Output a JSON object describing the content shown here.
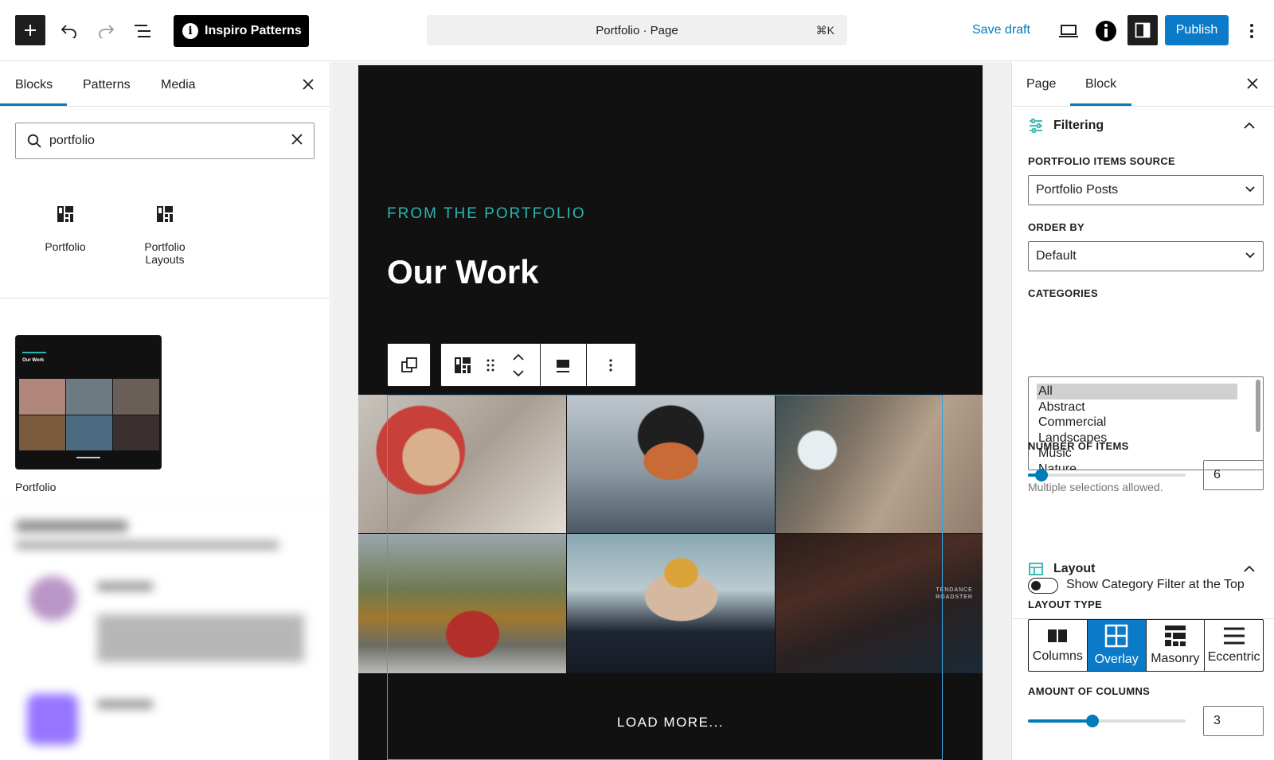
{
  "topbar": {
    "patterns_button": "Inspiro Patterns",
    "command_title": "Portfolio · Page",
    "command_shortcut": "⌘K",
    "save_draft": "Save draft",
    "publish": "Publish"
  },
  "inserter": {
    "tabs": [
      "Blocks",
      "Patterns",
      "Media"
    ],
    "active_tab": "Blocks",
    "search_value": "portfolio",
    "blocks": [
      {
        "label": "Portfolio"
      },
      {
        "label": "Portfolio Layouts"
      }
    ],
    "pattern_label": "Portfolio",
    "pattern_preview_title": "Our Work"
  },
  "canvas": {
    "kicker": "FROM THE PORTFOLIO",
    "title": "Our Work",
    "photo_sign": "TENDANCE\nROADSTER",
    "load_more": "LOAD MORE..."
  },
  "sidebar": {
    "tabs": [
      "Page",
      "Block"
    ],
    "active_tab": "Block",
    "filtering": {
      "title": "Filtering",
      "source_label": "PORTFOLIO ITEMS SOURCE",
      "source_value": "Portfolio Posts",
      "order_label": "ORDER BY",
      "order_value": "Default",
      "categories_label": "CATEGORIES",
      "categories": [
        "All",
        "Abstract",
        "Commercial",
        "Landscapes",
        "Music",
        "Nature"
      ],
      "selected_category": "All",
      "categories_help": "Multiple selections allowed.",
      "items_label": "NUMBER OF ITEMS",
      "items_value": "6",
      "items_fraction": 0.05,
      "toggle_label": "Show Category Filter at the Top",
      "toggle_on": false
    },
    "layout": {
      "title": "Layout",
      "type_label": "LAYOUT TYPE",
      "types": [
        "Columns",
        "Overlay",
        "Masonry",
        "Eccentric"
      ],
      "active_type": "Overlay",
      "columns_label": "AMOUNT OF COLUMNS",
      "columns_value": "3",
      "columns_fraction": 0.4
    }
  },
  "colors": {
    "accent": "#007cba",
    "publish": "#0a7ac9",
    "kicker": "#2bb5b0",
    "canvas_bg": "#111111"
  }
}
